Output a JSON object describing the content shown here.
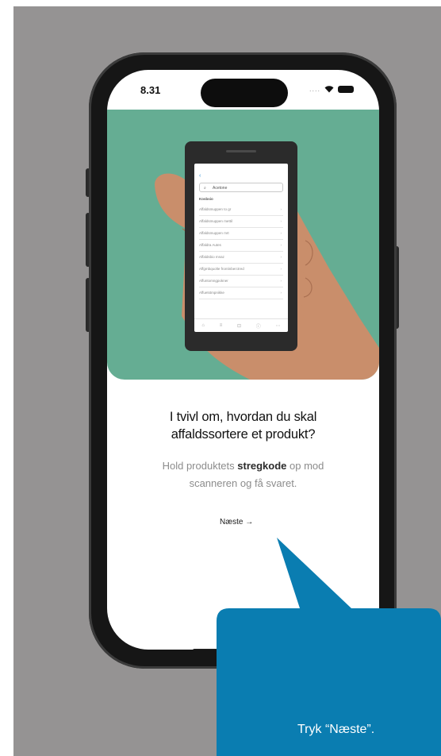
{
  "status_bar": {
    "time": "8.31",
    "dots": "...."
  },
  "mini_phone": {
    "back": "‹",
    "search_placeholder": "Acetone",
    "section_label": "Kosbsio",
    "rows": [
      "Affaldsmuppen to gr",
      "Affaldsmuppen mettil",
      "Affaldsmuppen mrt",
      "Affaldra Autes",
      "Affaldsbio mnaz",
      "Affgmbquolte frontinberctred",
      "Affuntomngpokner",
      "Affuetstmpnikke"
    ],
    "chevron": "›"
  },
  "onboarding": {
    "heading_line1": "I tvivl om, hvordan du skal",
    "heading_line2": "affaldssortere et produkt?",
    "body_pre": "Hold produktets ",
    "body_bold": "stregkode",
    "body_post": " op mod",
    "body_line2": "scanneren og få svaret.",
    "next_label": "Næste",
    "next_arrow": "→"
  },
  "callout": {
    "text": "Tryk “Næste”.",
    "color": "#0a7db1"
  },
  "colors": {
    "backdrop": "#959393",
    "hero": "#65ad93",
    "hand": "#c98e6b",
    "phone": "#161616"
  }
}
